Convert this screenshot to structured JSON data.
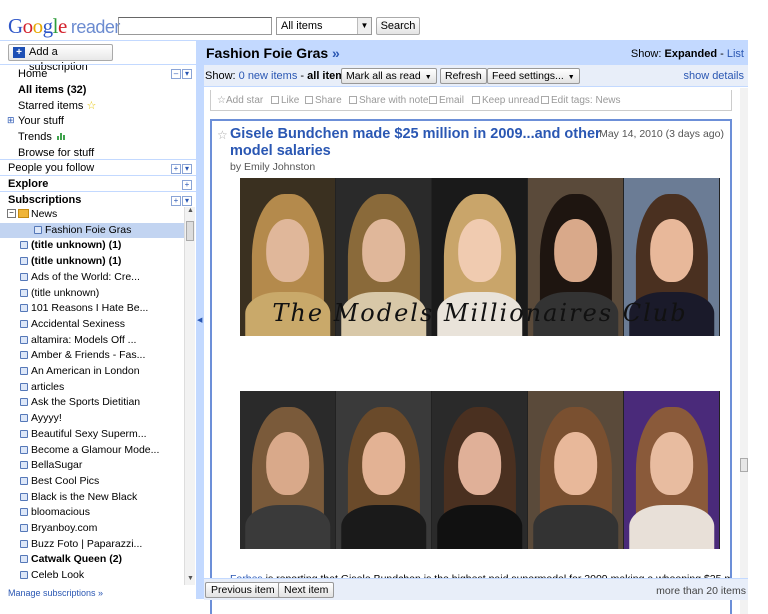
{
  "header": {
    "logo": {
      "google": "Google",
      "reader": "reader"
    },
    "search_value": "",
    "search_scope": "All items",
    "search_button": "Search"
  },
  "nav": {
    "add_subscription": "Add a subscription",
    "home": "Home",
    "all_items": "All items (32)",
    "starred": "Starred items",
    "your_stuff": "Your stuff",
    "trends": "Trends",
    "browse": "Browse for stuff",
    "people": "People you follow",
    "explore": "Explore",
    "subscriptions": "Subscriptions",
    "manage": "Manage subscriptions »"
  },
  "subscriptions": [
    {
      "label": "News",
      "type": "folder"
    },
    {
      "label": "Fashion Foie Gras",
      "type": "feed",
      "selected": true
    },
    {
      "label": "(title unknown) (1)",
      "type": "feed",
      "bold": true
    },
    {
      "label": "(title unknown) (1)",
      "type": "feed",
      "bold": true
    },
    {
      "label": "Ads of the World: Cre...",
      "type": "feed"
    },
    {
      "label": "(title unknown)",
      "type": "feed"
    },
    {
      "label": "101 Reasons I Hate Be...",
      "type": "feed"
    },
    {
      "label": "Accidental Sexiness",
      "type": "feed"
    },
    {
      "label": "altamira: Models Off ...",
      "type": "feed"
    },
    {
      "label": "Amber & Friends - Fas...",
      "type": "feed"
    },
    {
      "label": "An American in London",
      "type": "feed"
    },
    {
      "label": "articles",
      "type": "feed"
    },
    {
      "label": "Ask the Sports Dietitian",
      "type": "feed"
    },
    {
      "label": "Ayyyy!",
      "type": "feed"
    },
    {
      "label": "Beautiful Sexy Superm...",
      "type": "feed"
    },
    {
      "label": "Become a Glamour Mode...",
      "type": "feed"
    },
    {
      "label": "BellaSugar",
      "type": "feed"
    },
    {
      "label": "Best Cool Pics",
      "type": "feed"
    },
    {
      "label": "Black is the New Black",
      "type": "feed"
    },
    {
      "label": "bloomacious",
      "type": "feed"
    },
    {
      "label": "Bryanboy.com",
      "type": "feed"
    },
    {
      "label": "Buzz Foto | Paparazzi...",
      "type": "feed"
    },
    {
      "label": "Catwalk Queen (2)",
      "type": "feed",
      "bold": true
    },
    {
      "label": "Celeb Look",
      "type": "feed"
    }
  ],
  "main": {
    "feed_title": "Fashion Foie Gras",
    "raquo": "»",
    "show_label": "Show:",
    "view_expanded": "Expanded",
    "view_sep": "-",
    "view_list": "List",
    "show_prefix": "Show:",
    "new_items": "0 new items",
    "dash": "-",
    "all_items": "all items",
    "mark_all_read": "Mark all as read",
    "refresh": "Refresh",
    "feed_settings": "Feed settings...",
    "show_details": "show details",
    "actions": {
      "add_star": "Add star",
      "like": "Like",
      "share": "Share",
      "share_note": "Share with note",
      "email": "Email",
      "keep_unread": "Keep unread",
      "edit_tags": "Edit tags:",
      "tag_value": "News"
    },
    "entry": {
      "title": "Gisele Bundchen made $25 million in 2009...and other model salaries",
      "date": "May 14, 2010 (3 days ago)",
      "author": "by Emily Johnston",
      "banner_text": "The Models Millionaires Club",
      "body_link": "Forbes",
      "body_text": " is reporting that Gisele Bundchen is the highest paid supermodel for 2009 making a whooping $25 million"
    },
    "prev_item": "Previous item",
    "next_item": "Next item",
    "more_items": "more than 20 items"
  },
  "colors": {
    "accent": "#c3d9ff",
    "link": "#2a57b3",
    "selected": "#c2d4f1"
  }
}
